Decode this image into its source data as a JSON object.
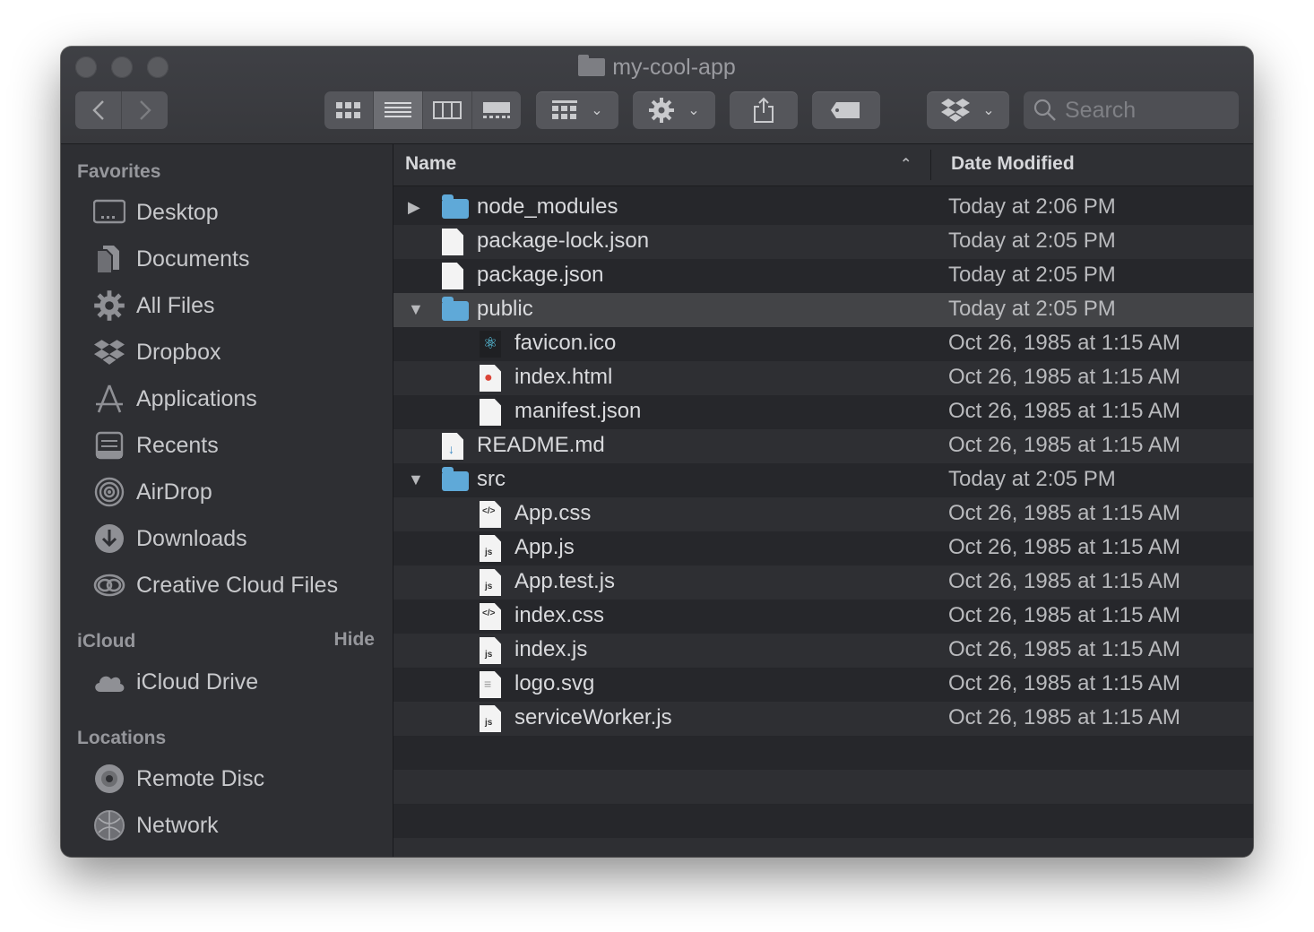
{
  "window": {
    "title": "my-cool-app"
  },
  "toolbar": {
    "search_placeholder": "Search",
    "back_label": "Back",
    "forward_label": "Forward",
    "view_modes": [
      "icons",
      "list",
      "columns",
      "gallery"
    ],
    "active_view": "list"
  },
  "sidebar": {
    "favorites_heading": "Favorites",
    "favorites": [
      {
        "label": "Desktop",
        "icon": "desktop-icon"
      },
      {
        "label": "Documents",
        "icon": "documents-icon"
      },
      {
        "label": "All Files",
        "icon": "gear-icon"
      },
      {
        "label": "Dropbox",
        "icon": "dropbox-icon"
      },
      {
        "label": "Applications",
        "icon": "applications-icon"
      },
      {
        "label": "Recents",
        "icon": "recents-icon"
      },
      {
        "label": "AirDrop",
        "icon": "airdrop-icon"
      },
      {
        "label": "Downloads",
        "icon": "downloads-icon"
      },
      {
        "label": "Creative Cloud Files",
        "icon": "creative-cloud-icon"
      }
    ],
    "icloud_heading": "iCloud",
    "icloud_hide": "Hide",
    "icloud": [
      {
        "label": "iCloud Drive",
        "icon": "cloud-icon"
      }
    ],
    "locations_heading": "Locations",
    "locations": [
      {
        "label": "Remote Disc",
        "icon": "disc-icon"
      },
      {
        "label": "Network",
        "icon": "network-icon"
      }
    ]
  },
  "list": {
    "columns": {
      "name": "Name",
      "date": "Date Modified"
    },
    "rows": [
      {
        "name": "node_modules",
        "date": "Today at 2:06 PM",
        "kind": "folder",
        "disclosure": "collapsed",
        "level": 0
      },
      {
        "name": "package-lock.json",
        "date": "Today at 2:05 PM",
        "kind": "file",
        "level": 0
      },
      {
        "name": "package.json",
        "date": "Today at 2:05 PM",
        "kind": "file",
        "level": 0
      },
      {
        "name": "public",
        "date": "Today at 2:05 PM",
        "kind": "folder",
        "disclosure": "expanded",
        "level": 0,
        "selected": true
      },
      {
        "name": "favicon.ico",
        "date": "Oct 26, 1985 at 1:15 AM",
        "kind": "react",
        "level": 1
      },
      {
        "name": "index.html",
        "date": "Oct 26, 1985 at 1:15 AM",
        "kind": "chrome",
        "level": 1
      },
      {
        "name": "manifest.json",
        "date": "Oct 26, 1985 at 1:15 AM",
        "kind": "file",
        "level": 1
      },
      {
        "name": "README.md",
        "date": "Oct 26, 1985 at 1:15 AM",
        "kind": "markdown",
        "level": 0
      },
      {
        "name": "src",
        "date": "Today at 2:05 PM",
        "kind": "folder",
        "disclosure": "expanded",
        "level": 0
      },
      {
        "name": "App.css",
        "date": "Oct 26, 1985 at 1:15 AM",
        "kind": "css",
        "level": 1
      },
      {
        "name": "App.js",
        "date": "Oct 26, 1985 at 1:15 AM",
        "kind": "js",
        "level": 1
      },
      {
        "name": "App.test.js",
        "date": "Oct 26, 1985 at 1:15 AM",
        "kind": "js",
        "level": 1
      },
      {
        "name": "index.css",
        "date": "Oct 26, 1985 at 1:15 AM",
        "kind": "css",
        "level": 1
      },
      {
        "name": "index.js",
        "date": "Oct 26, 1985 at 1:15 AM",
        "kind": "js",
        "level": 1
      },
      {
        "name": "logo.svg",
        "date": "Oct 26, 1985 at 1:15 AM",
        "kind": "text",
        "level": 1
      },
      {
        "name": "serviceWorker.js",
        "date": "Oct 26, 1985 at 1:15 AM",
        "kind": "js",
        "level": 1
      }
    ]
  },
  "colors": {
    "folder": "#5fa9d8",
    "row_even": "#26272b",
    "row_odd": "#2e2f33",
    "row_selected": "#434447"
  }
}
